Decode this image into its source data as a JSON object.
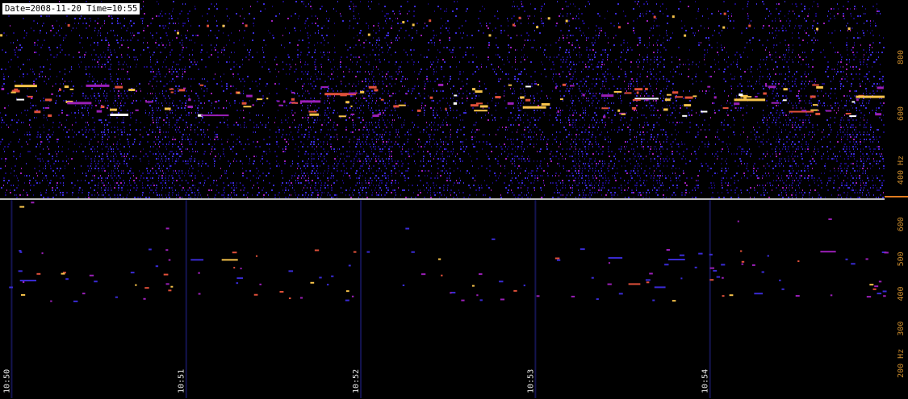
{
  "header": {
    "date_label": "Date=2008-11-20",
    "time_label": "Time=10:55"
  },
  "colors": {
    "background": "#000000",
    "axis_text": "#c98a2c",
    "divider": "#ffffff",
    "time_text": "#e6e6e6",
    "accent_marker": "#e07b1f"
  },
  "chart_data": [
    {
      "type": "heatmap",
      "panel": "top",
      "y_ticks": [
        "800",
        "600",
        "400 Hz"
      ],
      "y_tick_values": [
        800,
        600,
        400
      ],
      "ylim": [
        300,
        1000
      ],
      "xlim": [
        "10:49:56",
        "10:55:00"
      ],
      "grid": false,
      "colormap": [
        "#000000",
        "#1a0a7a",
        "#3a2bd6",
        "#9b1fb8",
        "#e0503a",
        "#f7c34a",
        "#ffffff"
      ]
    },
    {
      "type": "heatmap",
      "panel": "bottom",
      "y_ticks": [
        "600",
        "500",
        "400",
        "300",
        "200 Hz"
      ],
      "y_tick_values": [
        600,
        500,
        400,
        300,
        200
      ],
      "ylim": [
        100,
        670
      ],
      "x_ticks": [
        "10:50",
        "10:51",
        "10:52",
        "10:53",
        "10:54"
      ],
      "xlim": [
        "10:49:56",
        "10:55:00"
      ],
      "grid": "vertical lines at each minute",
      "colormap": [
        "#000000",
        "#1a0a7a",
        "#3a2bd6",
        "#9b1fb8",
        "#e0503a",
        "#f7c34a",
        "#ffffff"
      ]
    }
  ]
}
